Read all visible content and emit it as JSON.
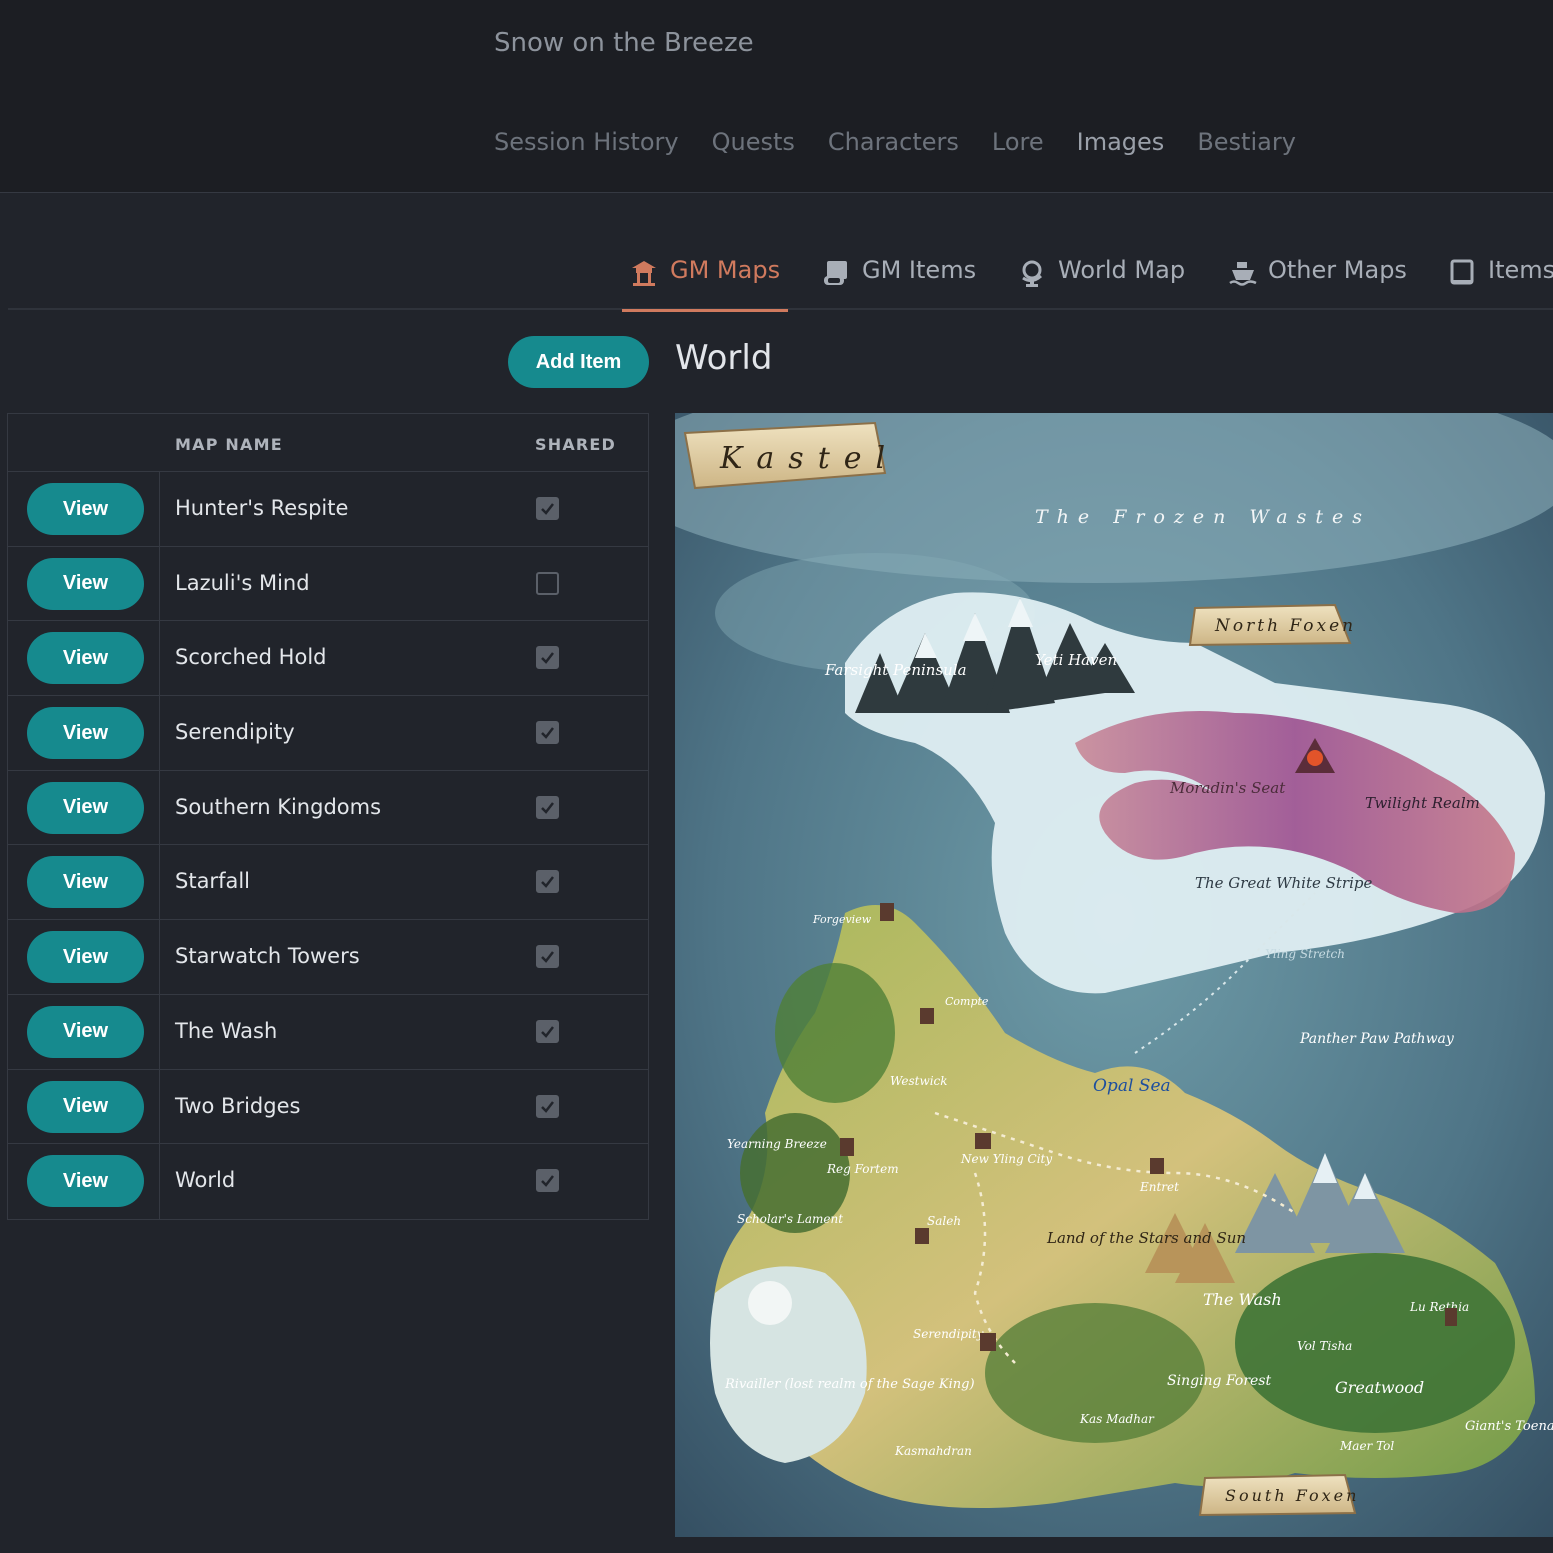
{
  "header": {
    "site_title": "Snow on the Breeze",
    "nav": [
      {
        "label": "Session History"
      },
      {
        "label": "Quests"
      },
      {
        "label": "Characters"
      },
      {
        "label": "Lore"
      },
      {
        "label": "Images",
        "active": true
      },
      {
        "label": "Bestiary"
      }
    ]
  },
  "tabs": [
    {
      "label": "GM Maps",
      "icon": "pagoda-icon",
      "active": true
    },
    {
      "label": "GM Items",
      "icon": "scroll-icon"
    },
    {
      "label": "World Map",
      "icon": "globe-icon"
    },
    {
      "label": "Other Maps",
      "icon": "ship-icon"
    },
    {
      "label": "Items",
      "icon": "book-icon"
    }
  ],
  "toolbar": {
    "add_label": "Add Item"
  },
  "detail": {
    "title": "World"
  },
  "table": {
    "columns": [
      "MAP NAME",
      "SHARED"
    ],
    "view_label": "View",
    "rows": [
      {
        "name": "Hunter's Respite",
        "shared": true
      },
      {
        "name": "Lazuli's Mind",
        "shared": false
      },
      {
        "name": "Scorched Hold",
        "shared": true
      },
      {
        "name": "Serendipity",
        "shared": true
      },
      {
        "name": "Southern Kingdoms",
        "shared": true
      },
      {
        "name": "Starfall",
        "shared": true
      },
      {
        "name": "Starwatch Towers",
        "shared": true
      },
      {
        "name": "The Wash",
        "shared": true
      },
      {
        "name": "Two Bridges",
        "shared": true
      },
      {
        "name": "World",
        "shared": true
      }
    ]
  },
  "map": {
    "banner_title": "Kastel",
    "labels": {
      "frozen_wastes": "The Frozen Wastes",
      "north_foxen": "North Foxen",
      "south_foxen": "South Foxen",
      "farsight": "Farsight Peninsula",
      "yeti_haven": "Yeti Haven",
      "moradins_seat": "Moradin's Seat",
      "twilight_realm": "Twilight Realm",
      "great_white_stripe": "The Great White Stripe",
      "yling_stretch": "Yling Stretch",
      "forgeview": "Forgeview",
      "compte": "Compte",
      "westwick": "Westwick",
      "opal_sea": "Opal Sea",
      "panther_paw": "Panther Paw Pathway",
      "yearning_breeze": "Yearning Breeze",
      "reg_fortem": "Reg Fortem",
      "new_yling_city": "New Yling City",
      "entret": "Entret",
      "scholars_lament": "Scholar's Lament",
      "saleh": "Saleh",
      "land_stars_sun": "Land of the Stars and Sun",
      "the_wash": "The Wash",
      "lu_rethia": "Lu Rethia",
      "rivailler": "Rivailler (lost realm of the Sage King)",
      "serendipity": "Serendipity",
      "vol_tisha": "Vol Tisha",
      "singing_forest": "Singing Forest",
      "greatwood": "Greatwood",
      "kas_madhar": "Kas Madhar",
      "kasmahdran": "Kasmahdran",
      "maer_tol": "Maer Tol",
      "giants_toenail": "Giant's Toenail"
    }
  }
}
